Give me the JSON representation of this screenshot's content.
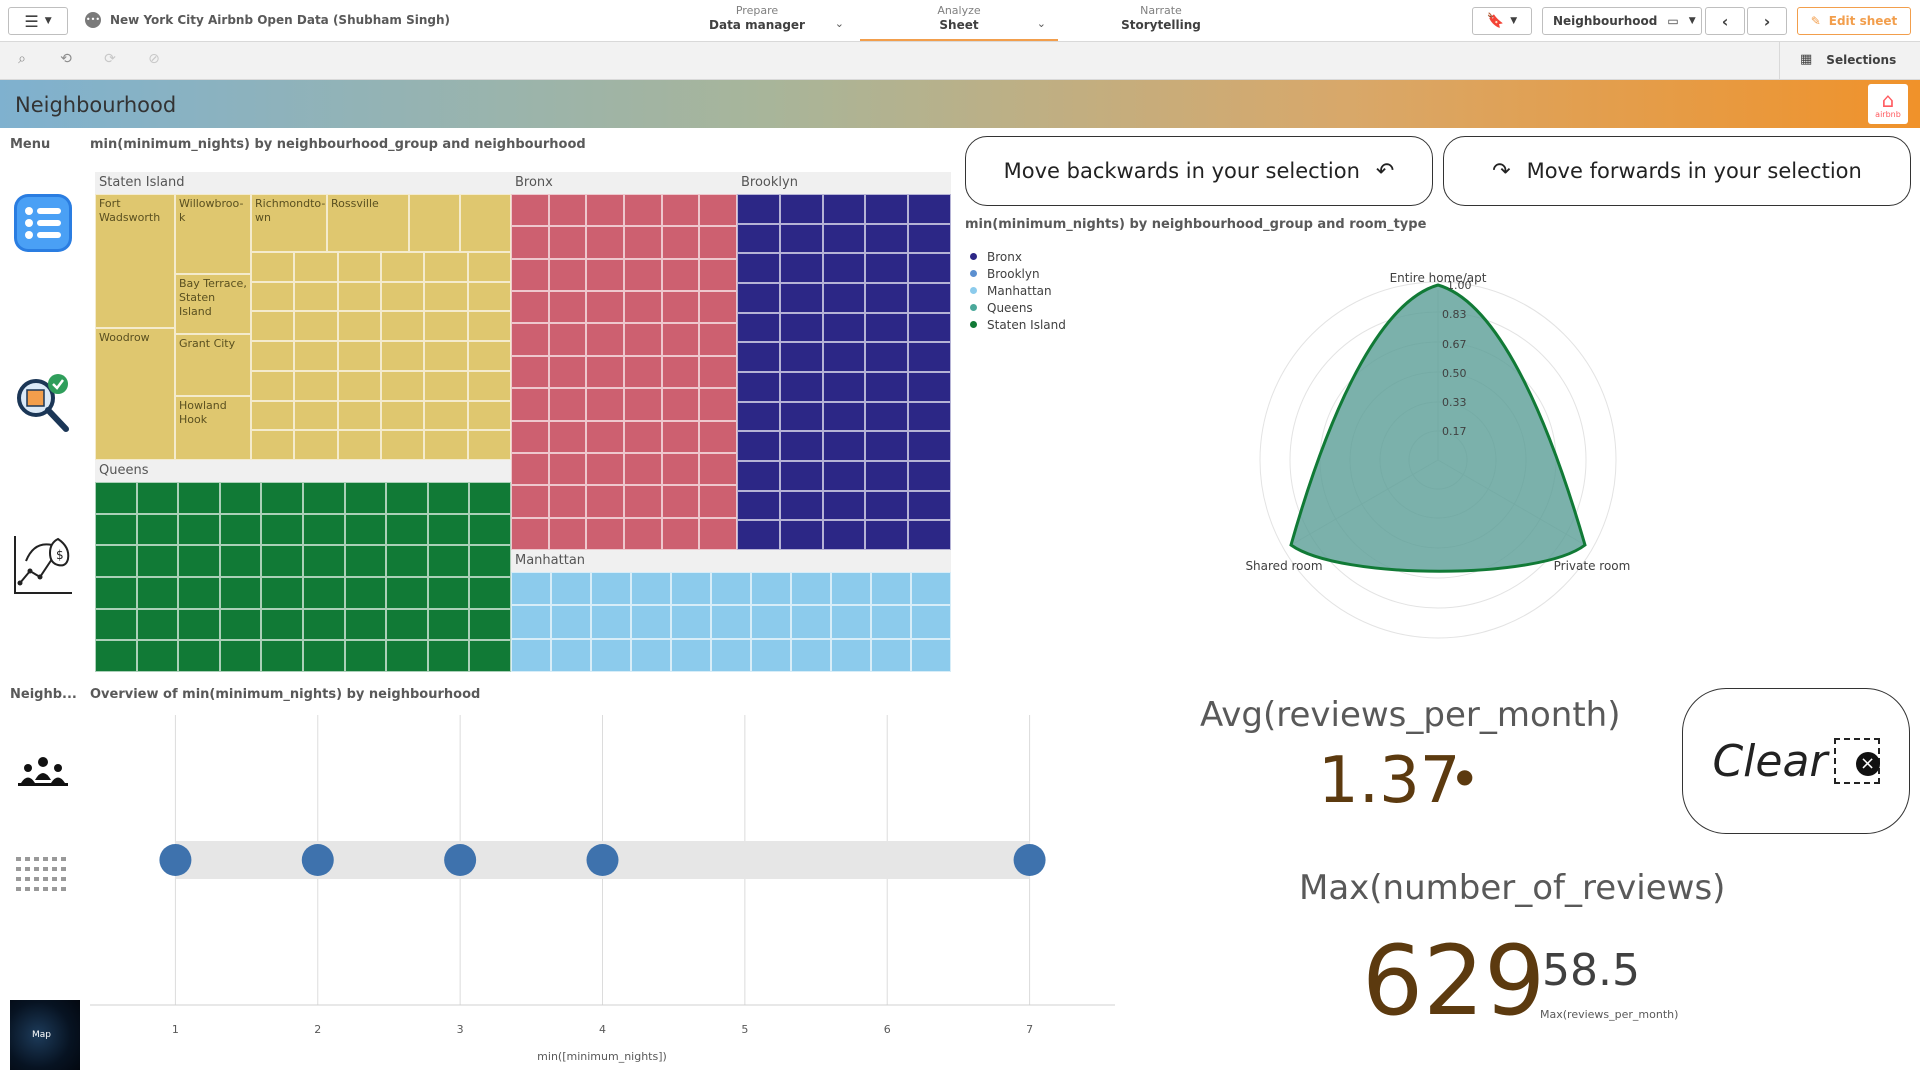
{
  "topbar": {
    "app_title": "New York City Airbnb Open Data (Shubham Singh)",
    "tabs": [
      {
        "small": "Prepare",
        "label": "Data manager"
      },
      {
        "small": "Analyze",
        "label": "Sheet"
      },
      {
        "small": "Narrate",
        "label": "Storytelling"
      }
    ],
    "sheet_selector": "Neighbourhood",
    "edit_label": "Edit sheet",
    "selections_label": "Selections"
  },
  "banner": {
    "title": "Neighbourhood",
    "logo_text": "airbnb"
  },
  "side": {
    "menu_label": "Menu",
    "neigh_label": "Neighb...",
    "map_label": "Map"
  },
  "treemap": {
    "title": "min(minimum_nights) by neighbourhood_group and neighbourhood",
    "groups": {
      "staten": "Staten Island",
      "queens": "Queens",
      "bronx": "Bronx",
      "brooklyn": "Brooklyn",
      "manhattan": "Manhattan"
    },
    "staten_cells": {
      "fort": "Fort Wadsworth",
      "willow": "Willowbroo-k",
      "richmond": "Richmondto-wn",
      "ross": "Rossville",
      "woodrow": "Woodrow",
      "bay": "Bay Terrace, Staten Island",
      "grant": "Grant City",
      "howland": "Howland Hook"
    },
    "colors": {
      "staten": "#dfc76f",
      "queens": "#117a36",
      "bronx": "#cd6070",
      "brooklyn": "#2c2786",
      "manhattan": "#8ccbec"
    }
  },
  "buttons": {
    "back_label": "Move backwards in your selection",
    "forward_label": "Move forwards in your selection",
    "clear_label": "Clear"
  },
  "radar": {
    "title": "min(minimum_nights) by neighbourhood_group and room_type",
    "legend": [
      {
        "name": "Bronx",
        "color": "#2c2786"
      },
      {
        "name": "Brooklyn",
        "color": "#5b8fd0"
      },
      {
        "name": "Manhattan",
        "color": "#8ccbec"
      },
      {
        "name": "Queens",
        "color": "#4aa89a"
      },
      {
        "name": "Staten Island",
        "color": "#117a36"
      }
    ],
    "axes": [
      "Entire home/apt",
      "Private room",
      "Shared room"
    ],
    "ticks": [
      "1.00",
      "0.83",
      "0.67",
      "0.50",
      "0.33",
      "0.17"
    ]
  },
  "distribution": {
    "title": "Overview of min(minimum_nights) by neighbourhood",
    "xlabel": "min([minimum_nights])",
    "ticks": [
      "1",
      "2",
      "3",
      "4",
      "5",
      "6",
      "7"
    ]
  },
  "chart_data": {
    "type": "scatter",
    "title": "Overview of min(minimum_nights) by neighbourhood",
    "xlabel": "min([minimum_nights])",
    "x": [
      1,
      2,
      3,
      4,
      7
    ],
    "xlim": [
      0.4,
      7.6
    ]
  },
  "kpi1": {
    "label": "Avg(reviews_per_month)",
    "value": "1.37"
  },
  "kpi2": {
    "label": "Max(number_of_reviews)",
    "value": "629",
    "secondary_value": "58.5",
    "secondary_label": "Max(reviews_per_month)"
  }
}
